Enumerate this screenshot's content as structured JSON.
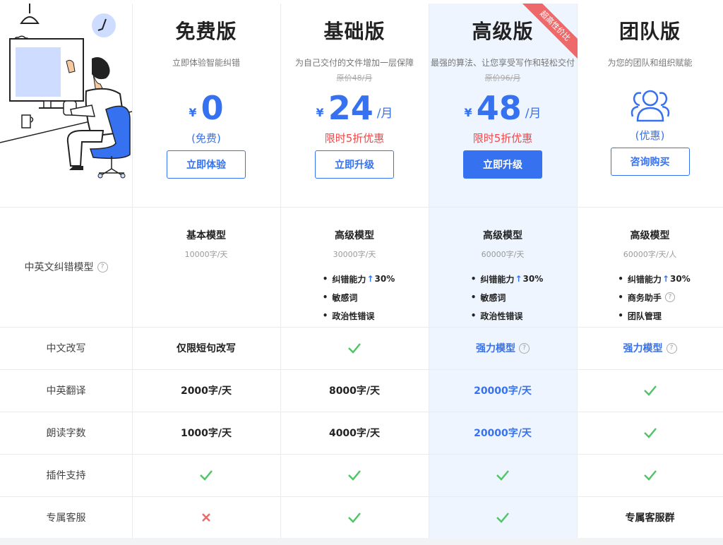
{
  "plans": [
    {
      "title": "免费版",
      "desc": "立即体验智能纠错",
      "orig": "",
      "yen": "¥",
      "price": "0",
      "unit": "",
      "sub": "(免费)",
      "button": "立即体验"
    },
    {
      "title": "基础版",
      "desc": "为自己交付的文件增加一层保障",
      "orig": "原价48/月",
      "yen": "¥",
      "price": "24",
      "unit": "/月",
      "sub": "限时5折优惠",
      "button": "立即升级"
    },
    {
      "title": "高级版",
      "desc": "最强的算法、让您享受写作和轻松交付",
      "orig": "原价96/月",
      "yen": "¥",
      "price": "48",
      "unit": "/月",
      "sub": "限时5折优惠",
      "button": "立即升级",
      "ribbon": "超高性价比"
    },
    {
      "title": "团队版",
      "desc": "为您的团队和组织赋能",
      "orig": "",
      "sub": "(优惠)",
      "button": "咨询购买"
    }
  ],
  "rows": {
    "model": {
      "label": "中英文纠错模型",
      "cols": [
        {
          "name": "基本模型",
          "quota": "10000字/天",
          "features": []
        },
        {
          "name": "高级模型",
          "quota": "30000字/天",
          "features": [
            "纠错能力",
            "敏感词",
            "政治性错误"
          ],
          "boost": "30%"
        },
        {
          "name": "高级模型",
          "quota": "60000字/天",
          "features": [
            "纠错能力",
            "敏感词",
            "政治性错误"
          ],
          "boost": "30%"
        },
        {
          "name": "高级模型",
          "quota": "60000字/天/人",
          "features": [
            "纠错能力",
            "商务助手",
            "团队管理"
          ],
          "boost": "30%"
        }
      ]
    },
    "rewrite": {
      "label": "中文改写",
      "free": "仅限短句改写",
      "advanced": "强力模型",
      "team": "强力模型"
    },
    "translate": {
      "label": "中英翻译",
      "free": "2000字/天",
      "basic": "8000字/天",
      "advanced": "20000字/天"
    },
    "read": {
      "label": "朗读字数",
      "free": "1000字/天",
      "basic": "4000字/天",
      "advanced": "20000字/天"
    },
    "plugin": {
      "label": "插件支持"
    },
    "service": {
      "label": "专属客服",
      "team": "专属客服群"
    }
  },
  "icons": {
    "check": "check-icon",
    "cross": "cross-icon",
    "help": "help-icon",
    "team": "team-icon"
  },
  "colors": {
    "accent": "#3672f0",
    "red": "#ee4b4b",
    "green": "#52c46a",
    "highlight_bg": "#eef5ff"
  }
}
